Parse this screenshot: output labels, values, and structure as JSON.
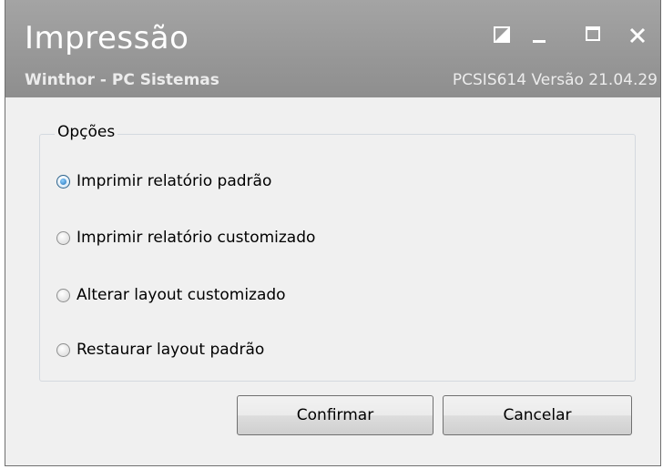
{
  "window": {
    "title": "Impressão",
    "subtitle": "Winthor - PC Sistemas",
    "version": "PCSIS614   Versão 21.04.29",
    "controls": [
      "resize-icon",
      "minimize-icon",
      "maximize-icon",
      "close-icon"
    ]
  },
  "options": {
    "group_label": "Opções",
    "items": [
      {
        "label": "Imprimir relatório padrão",
        "selected": true
      },
      {
        "label": "Imprimir relatório customizado",
        "selected": false
      },
      {
        "label": "Alterar layout customizado",
        "selected": false
      },
      {
        "label": "Restaurar layout padrão",
        "selected": false
      }
    ]
  },
  "buttons": {
    "confirm": "Confirmar",
    "cancel": "Cancelar"
  },
  "colors": {
    "titlebar": "#999999",
    "body": "#f0f0f0",
    "radio_selected": "#1f6fb6"
  }
}
